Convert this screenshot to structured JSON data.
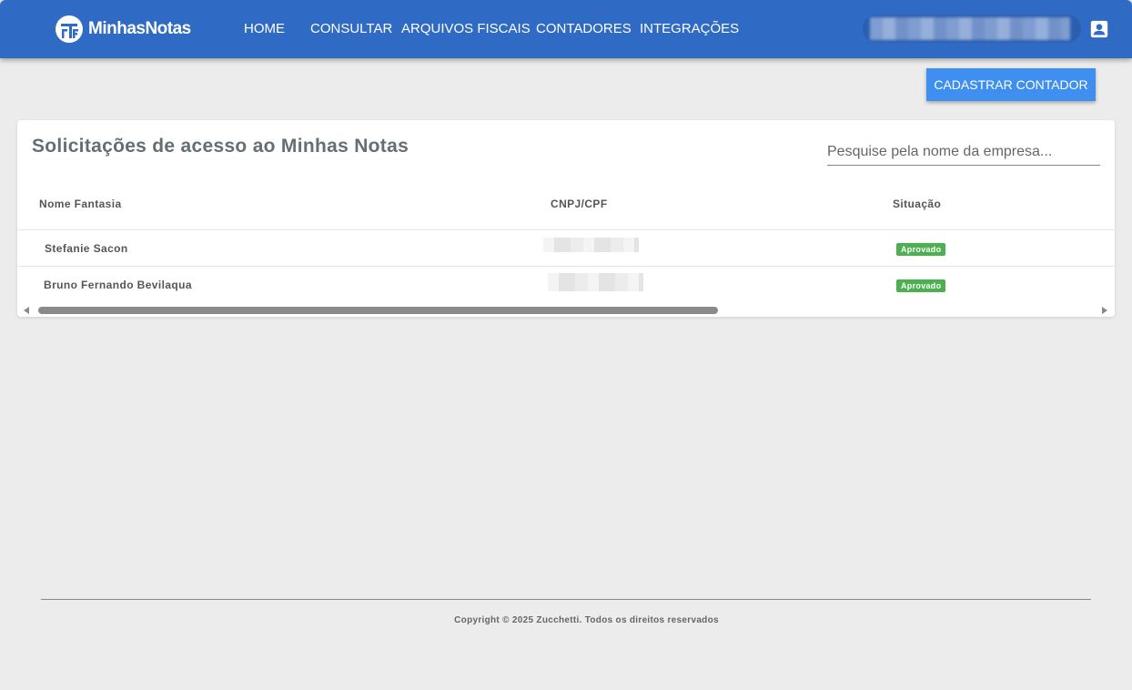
{
  "header": {
    "brand": "MinhasNotas",
    "nav": [
      {
        "label": "HOME"
      },
      {
        "label": "CONSULTAR"
      },
      {
        "label": "ARQUIVOS FISCAIS"
      },
      {
        "label": "CONTADORES"
      },
      {
        "label": "INTEGRAÇÕES"
      }
    ],
    "user_icon": "account-box-icon",
    "color": "#2f6bc4"
  },
  "actions": {
    "register_label": "CADASTRAR CONTADOR",
    "color": "#3f8ff0"
  },
  "card": {
    "title": "Solicitações de acesso ao Minhas Notas",
    "search_placeholder": "Pesquise pela nome da empresa...",
    "columns": [
      "Nome Fantasia",
      "CNPJ/CPF",
      "Situação"
    ],
    "rows": [
      {
        "name": "Stefanie Sacon",
        "status": "Aprovado"
      },
      {
        "name": "Bruno Fernando Bevilaqua",
        "status": "Aprovado"
      }
    ],
    "status_color": "#4caf50"
  },
  "footer": {
    "copyright": "Copyright © 2025 Zucchetti. Todos os direitos reservados"
  }
}
